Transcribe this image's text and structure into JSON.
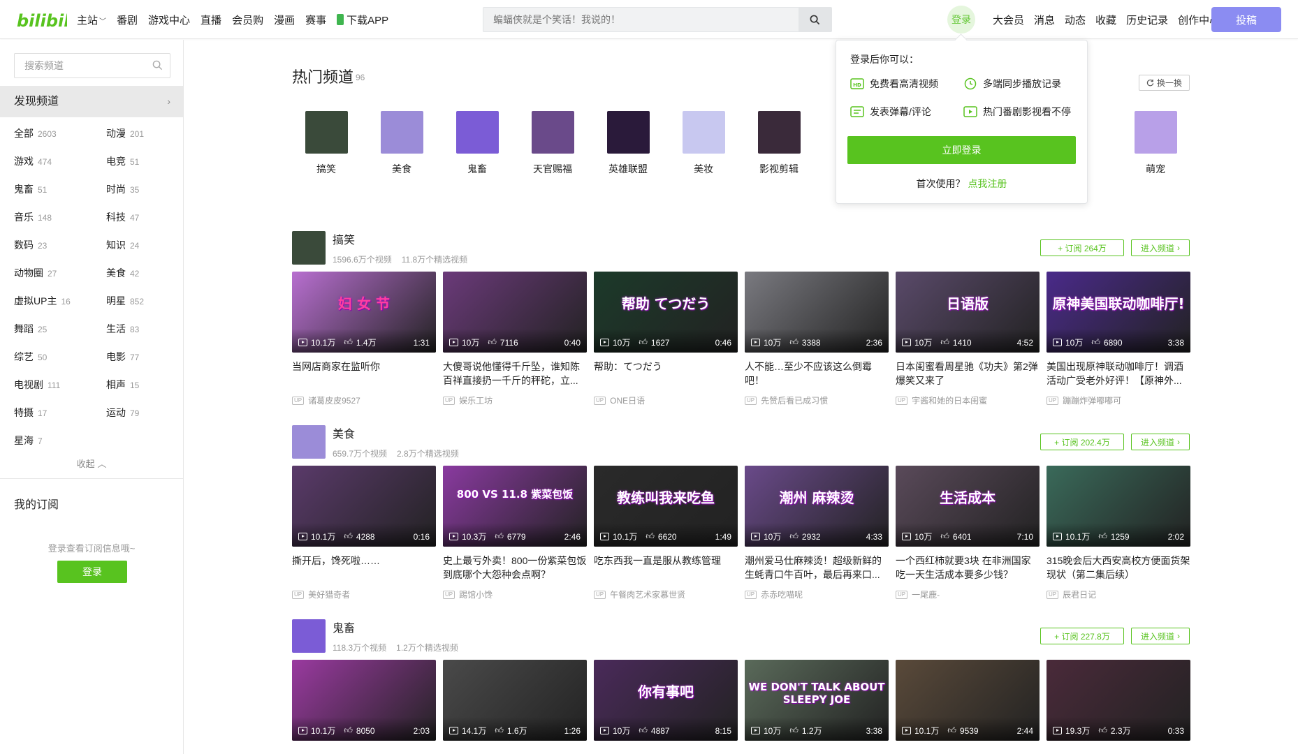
{
  "header": {
    "logo_text": "bilibili",
    "nav": [
      {
        "label": "主站",
        "chevron": true
      },
      {
        "label": "番剧"
      },
      {
        "label": "游戏中心"
      },
      {
        "label": "直播"
      },
      {
        "label": "会员购"
      },
      {
        "label": "漫画"
      },
      {
        "label": "赛事"
      },
      {
        "label": "下载APP",
        "icon": "phone-icon"
      }
    ],
    "search_placeholder": "蝙蝠侠就是个笑话！我说的！",
    "login_label": "登录",
    "right_nav": [
      "大会员",
      "消息",
      "动态",
      "收藏",
      "历史记录",
      "创作中心"
    ],
    "upload_label": "投稿",
    "accent": "#58c31f",
    "upload_color": "#8b8cf2"
  },
  "sidebar": {
    "search_placeholder": "搜索频道",
    "discover_label": "发现频道",
    "categories": [
      {
        "name": "全部",
        "count": "2603"
      },
      {
        "name": "动漫",
        "count": "201"
      },
      {
        "name": "游戏",
        "count": "474"
      },
      {
        "name": "电竞",
        "count": "51"
      },
      {
        "name": "鬼畜",
        "count": "51"
      },
      {
        "name": "时尚",
        "count": "35"
      },
      {
        "name": "音乐",
        "count": "148"
      },
      {
        "name": "科技",
        "count": "47"
      },
      {
        "name": "数码",
        "count": "23"
      },
      {
        "name": "知识",
        "count": "24"
      },
      {
        "name": "动物圈",
        "count": "27"
      },
      {
        "name": "美食",
        "count": "42"
      },
      {
        "name": "虚拟UP主",
        "count": "16"
      },
      {
        "name": "明星",
        "count": "852"
      },
      {
        "name": "舞蹈",
        "count": "25"
      },
      {
        "name": "生活",
        "count": "83"
      },
      {
        "name": "综艺",
        "count": "50"
      },
      {
        "name": "电影",
        "count": "77"
      },
      {
        "name": "电视剧",
        "count": "111"
      },
      {
        "name": "相声",
        "count": "15"
      },
      {
        "name": "特摄",
        "count": "17"
      },
      {
        "name": "运动",
        "count": "79"
      },
      {
        "name": "星海",
        "count": "7"
      }
    ],
    "collapse_label": "收起",
    "my_sub_label": "我的订阅",
    "login_hint": "登录查看订阅信息哦~",
    "login_label": "登录"
  },
  "hot": {
    "title": "热门频道",
    "count": "96",
    "refresh_label": "换一换",
    "items": [
      {
        "label": "搞笑",
        "color": "#3a4a3a"
      },
      {
        "label": "美食",
        "color": "#9b8cd8"
      },
      {
        "label": "鬼畜",
        "color": "#7b5cd6"
      },
      {
        "label": "天官赐福",
        "color": "#6a4a8a"
      },
      {
        "label": "英雄联盟",
        "color": "#2a1a3a"
      },
      {
        "label": "美妆",
        "color": "#c8c8f0"
      },
      {
        "label": "影视剪辑",
        "color": "#3a2a3a"
      },
      {
        "label": "萌宠",
        "color": "#b8a0e8"
      }
    ]
  },
  "popup": {
    "title": "登录后你可以：",
    "features": [
      "免费看高清视频",
      "多端同步播放记录",
      "发表弹幕/评论",
      "热门番剧影视看不停"
    ],
    "login_label": "立即登录",
    "first_use": "首次使用？",
    "register_label": "点我注册"
  },
  "sections": [
    {
      "name": "搞笑",
      "videos_stat": "1596.6万个视频",
      "featured_stat": "11.8万个精选视频",
      "subscribe_label": "+ 订阅 264万",
      "enter_label": "进入频道",
      "avatar_color": "#3a4a3a",
      "videos": [
        {
          "title": "当网店商家在监听你",
          "views": "10.1万",
          "likes": "1.4万",
          "duration": "1:31",
          "up": "诸葛皮皮9527",
          "bg": "#b86fd0",
          "overlay": "妇 女 节"
        },
        {
          "title": "大傻哥说他懂得千斤坠，谁知陈百祥直接扔一千斤的秤砣，立...",
          "views": "10万",
          "likes": "7116",
          "duration": "0:40",
          "up": "娱乐工坊",
          "bg": "#6b3a7a",
          "overlay": ""
        },
        {
          "title": "帮助：てつだう",
          "views": "10万",
          "likes": "1627",
          "duration": "0:46",
          "up": "ONE日语",
          "bg": "#1c3a2a",
          "overlay": "帮助 てつだう"
        },
        {
          "title": "人不能…至少不应该这么倒霉吧！",
          "views": "10万",
          "likes": "3388",
          "duration": "2:36",
          "up": "先赞后看已成习惯",
          "bg": "#7a7a80",
          "overlay": ""
        },
        {
          "title": "日本闺蜜看周星驰《功夫》第2弹 爆笑又来了",
          "views": "10万",
          "likes": "1410",
          "duration": "4:52",
          "up": "宇酱和她的日本闺蜜",
          "bg": "#5a4a6a",
          "overlay": "日语版"
        },
        {
          "title": "美国出现原神联动咖啡厅！调酒活动广受老外好评！【原神外...",
          "views": "10万",
          "likes": "6890",
          "duration": "3:38",
          "up": "蹦蹦炸弹嘟嘟可",
          "bg": "#4a2a8a",
          "overlay": "原神美国联动咖啡厅!"
        }
      ]
    },
    {
      "name": "美食",
      "videos_stat": "659.7万个视频",
      "featured_stat": "2.8万个精选视频",
      "subscribe_label": "+ 订阅 202.4万",
      "enter_label": "进入频道",
      "avatar_color": "#9b8cd8",
      "videos": [
        {
          "title": "撕开后，馋死啦……",
          "views": "10.1万",
          "likes": "4288",
          "duration": "0:16",
          "up": "美好猎奇者",
          "bg": "#5a3a6a",
          "overlay": ""
        },
        {
          "title": "史上最亏外卖！800一份紫菜包饭到底哪个大怨种会点啊？",
          "views": "10.3万",
          "likes": "6779",
          "duration": "2:46",
          "up": "踢馆小馋",
          "bg": "#8a3aa0",
          "overlay": "800 VS 11.8 紫菜包饭"
        },
        {
          "title": "吃东西我一直是服从教练管理",
          "views": "10.1万",
          "likes": "6620",
          "duration": "1:49",
          "up": "午餐肉艺术家慕世贤",
          "bg": "#2a2a2a",
          "overlay": "教练叫我来吃鱼"
        },
        {
          "title": "潮州爱马仕麻辣烫！超级新鲜的生蚝青口牛百叶，最后再来口...",
          "views": "10万",
          "likes": "2932",
          "duration": "4:33",
          "up": "赤赤吃喵呢",
          "bg": "#6a4a8a",
          "overlay": "潮州 麻辣烫"
        },
        {
          "title": "一个西红柿就要3块 在非洲国家吃一天生活成本要多少钱？",
          "views": "10万",
          "likes": "6401",
          "duration": "7:10",
          "up": "一尾鹿-",
          "bg": "#5a4a5a",
          "overlay": "生活成本"
        },
        {
          "title": "315晚会后大西安高校方便面货架现状（第二集后续）",
          "views": "10.1万",
          "likes": "1259",
          "duration": "2:02",
          "up": "辰君日记",
          "bg": "#3a6a5a",
          "overlay": ""
        }
      ]
    },
    {
      "name": "鬼畜",
      "videos_stat": "118.3万个视频",
      "featured_stat": "1.2万个精选视频",
      "subscribe_label": "+ 订阅 227.8万",
      "enter_label": "进入频道",
      "avatar_color": "#7b5cd6",
      "videos": [
        {
          "title": "",
          "views": "10.1万",
          "likes": "8050",
          "duration": "2:03",
          "up": "",
          "bg": "#9a3aa0",
          "overlay": ""
        },
        {
          "title": "",
          "views": "14.1万",
          "likes": "1.6万",
          "duration": "1:26",
          "up": "",
          "bg": "#4a4a4a",
          "overlay": ""
        },
        {
          "title": "",
          "views": "10万",
          "likes": "4887",
          "duration": "8:15",
          "up": "",
          "bg": "#4a2a5a",
          "overlay": "你有事吧"
        },
        {
          "title": "",
          "views": "10万",
          "likes": "1.2万",
          "duration": "3:38",
          "up": "",
          "bg": "#5a6a5a",
          "overlay": "WE DON'T TALK ABOUT SLEEPY JOE"
        },
        {
          "title": "",
          "views": "10.1万",
          "likes": "9539",
          "duration": "2:44",
          "up": "",
          "bg": "#5a4a3a",
          "overlay": ""
        },
        {
          "title": "",
          "views": "19.3万",
          "likes": "2.3万",
          "duration": "0:33",
          "up": "",
          "bg": "#4a2a3a",
          "overlay": ""
        }
      ]
    }
  ]
}
